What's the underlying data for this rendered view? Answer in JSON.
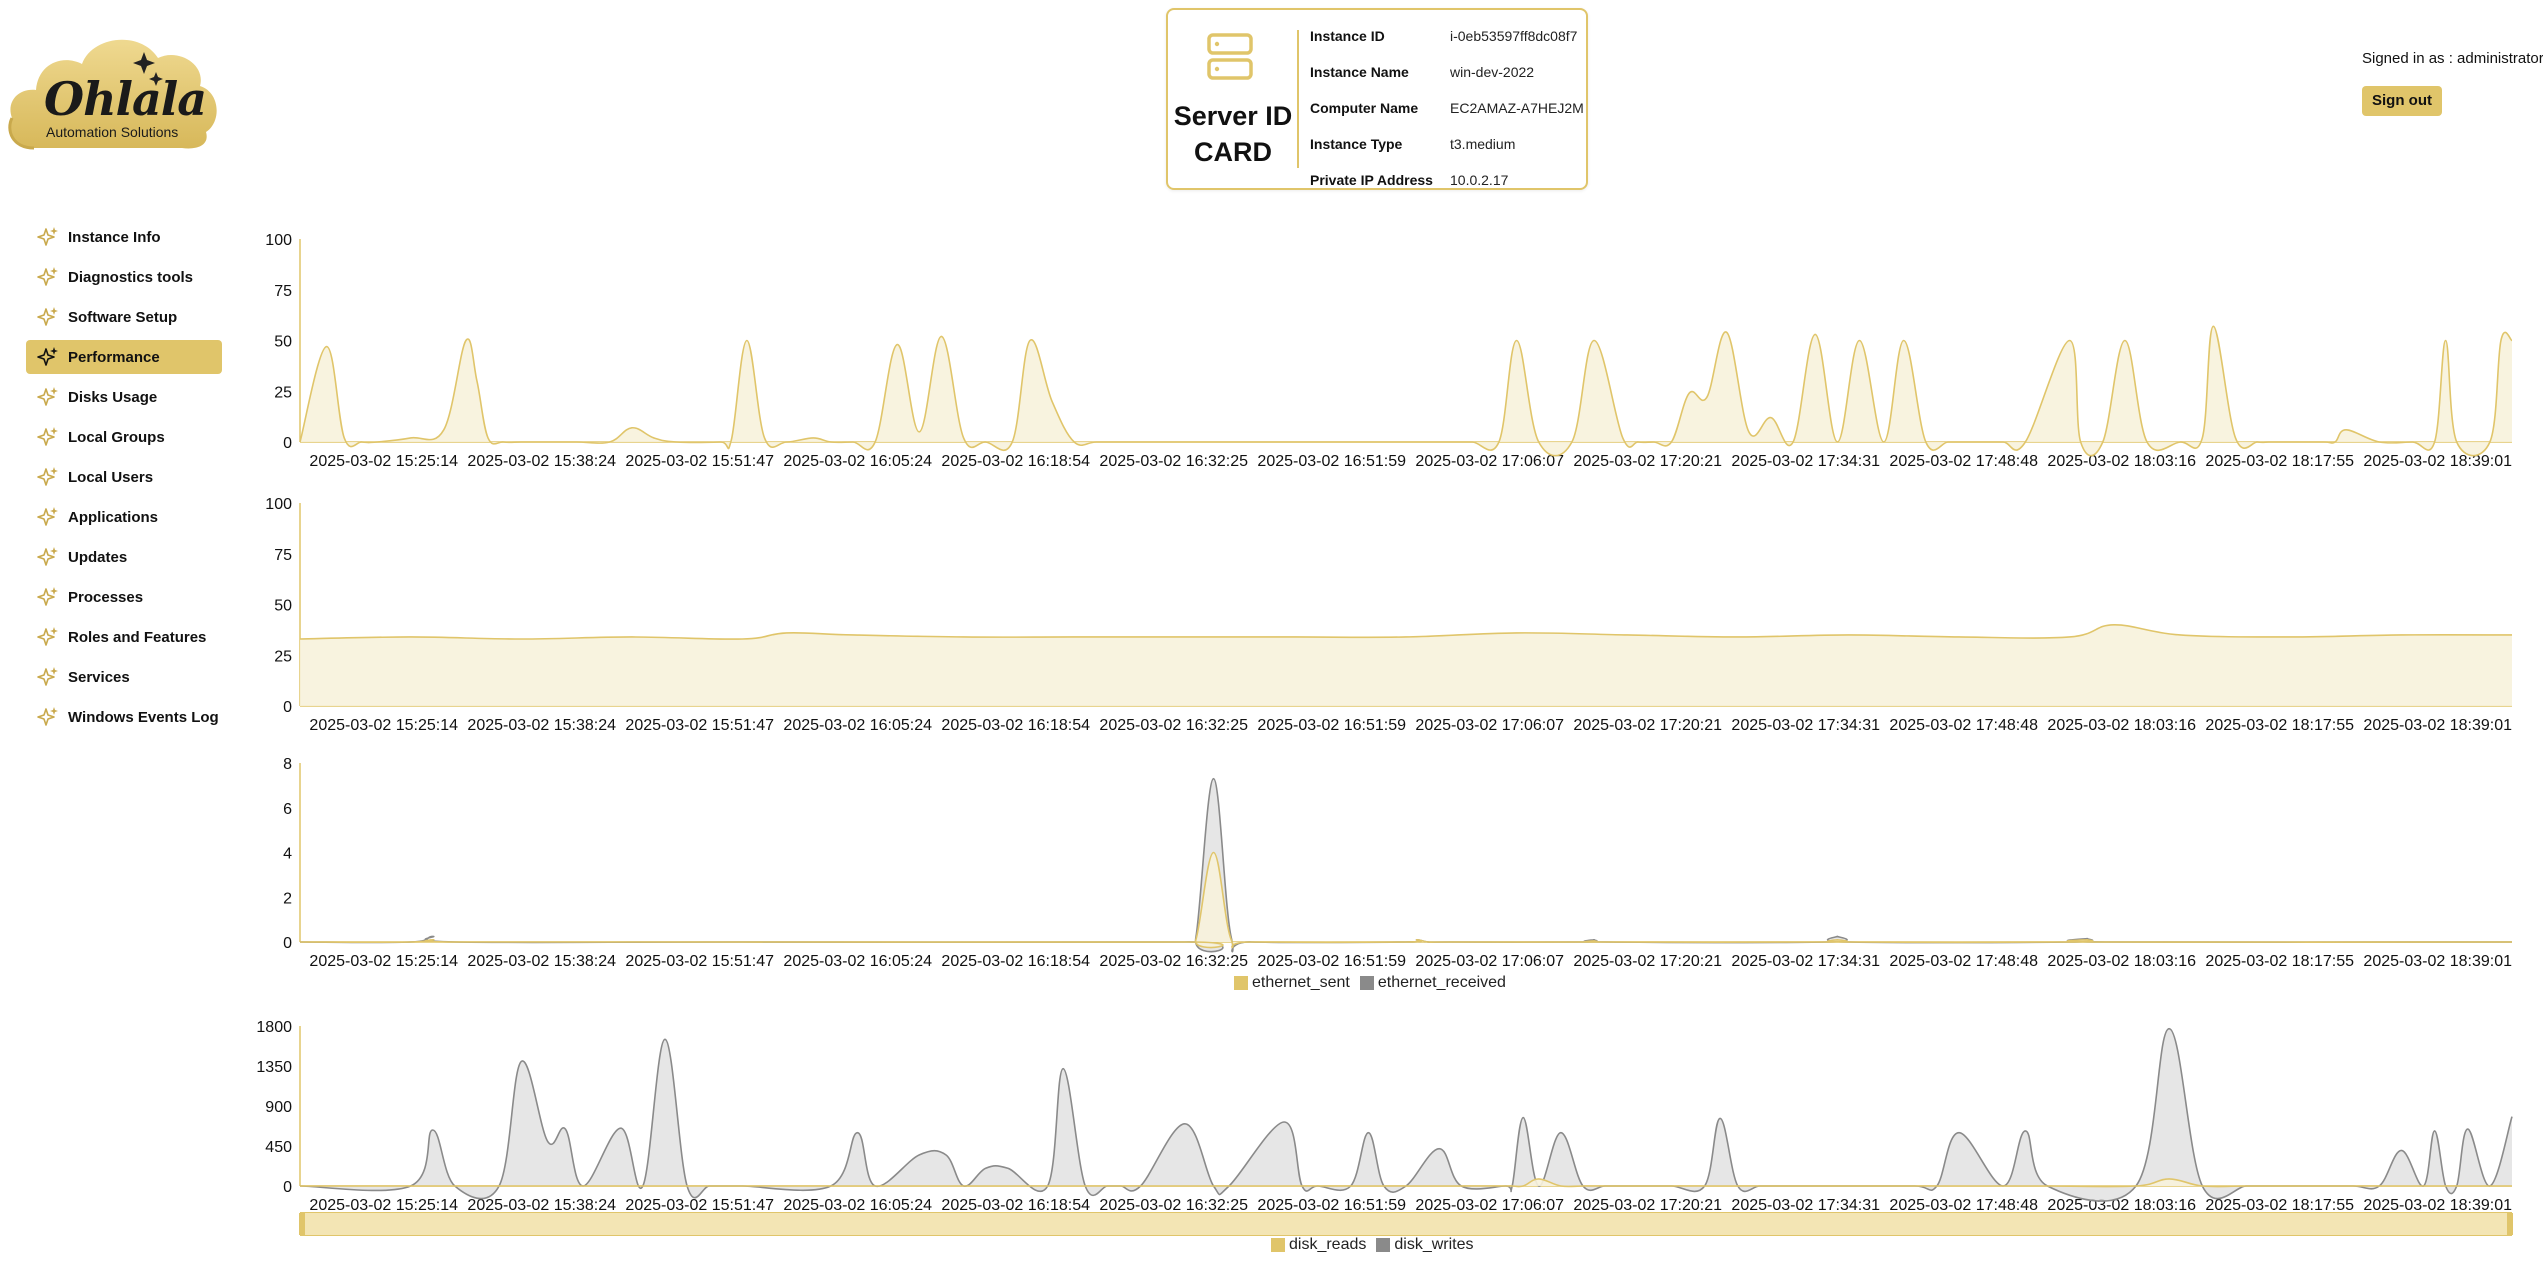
{
  "app": {
    "logo_text": "Ohlala",
    "logo_subtitle": "Automation Solutions"
  },
  "id_card": {
    "title_line1": "Server ID",
    "title_line2": "CARD",
    "rows": [
      {
        "key": "Instance ID",
        "value": "i-0eb53597ff8dc08f7"
      },
      {
        "key": "Instance Name",
        "value": "win-dev-2022"
      },
      {
        "key": "Computer Name",
        "value": "EC2AMAZ-A7HEJ2M"
      },
      {
        "key": "Instance Type",
        "value": "t3.medium"
      },
      {
        "key": "Private IP Address",
        "value": "10.0.2.17"
      }
    ]
  },
  "user": {
    "signed_in_text": "Signed in as : administrator",
    "sign_out_label": "Sign out"
  },
  "sidebar": {
    "items": [
      {
        "label": "Instance Info",
        "icon": "sparkle-icon",
        "active": false
      },
      {
        "label": "Diagnostics tools",
        "icon": "sparkle-icon",
        "active": false
      },
      {
        "label": "Software Setup",
        "icon": "sparkle-icon",
        "active": false
      },
      {
        "label": "Performance",
        "icon": "sparkle-icon",
        "active": true
      },
      {
        "label": "Disks Usage",
        "icon": "sparkle-icon",
        "active": false
      },
      {
        "label": "Local Groups",
        "icon": "sparkle-icon",
        "active": false
      },
      {
        "label": "Local Users",
        "icon": "sparkle-icon",
        "active": false
      },
      {
        "label": "Applications",
        "icon": "sparkle-icon",
        "active": false
      },
      {
        "label": "Updates",
        "icon": "sparkle-icon",
        "active": false
      },
      {
        "label": "Processes",
        "icon": "sparkle-icon",
        "active": false
      },
      {
        "label": "Roles and Features",
        "icon": "sparkle-icon",
        "active": false
      },
      {
        "label": "Services",
        "icon": "sparkle-icon",
        "active": false
      },
      {
        "label": "Windows Events Log",
        "icon": "sparkle-icon",
        "active": false
      }
    ]
  },
  "colors": {
    "accent": "#e0c56a",
    "fill_light": "#f7f2dc",
    "grey_line": "#8a8a8a",
    "grey_fill": "#e2e2e2"
  },
  "chart_data": [
    {
      "type": "area",
      "x_ticks": [
        "2025-03-02 15:25:14",
        "2025-03-02 15:38:24",
        "2025-03-02 15:51:47",
        "2025-03-02 16:05:24",
        "2025-03-02 16:18:54",
        "2025-03-02 16:32:25",
        "2025-03-02 16:51:59",
        "2025-03-02 17:06:07",
        "2025-03-02 17:20:21",
        "2025-03-02 17:34:31",
        "2025-03-02 17:48:48",
        "2025-03-02 18:03:16",
        "2025-03-02 18:17:55",
        "2025-03-02 18:39:01"
      ],
      "y_ticks": [
        "0",
        "25",
        "50",
        "75",
        "100"
      ],
      "ylim": [
        0,
        100
      ],
      "x": [
        0.0,
        0.012,
        0.02,
        0.028,
        0.035,
        0.05,
        0.065,
        0.075,
        0.08,
        0.085,
        0.092,
        0.1,
        0.11,
        0.125,
        0.14,
        0.15,
        0.16,
        0.17,
        0.19,
        0.195,
        0.202,
        0.21,
        0.22,
        0.232,
        0.24,
        0.25,
        0.26,
        0.27,
        0.28,
        0.29,
        0.3,
        0.31,
        0.322,
        0.33,
        0.34,
        0.35,
        0.36,
        0.375,
        0.39,
        0.4,
        0.41,
        0.42,
        0.44,
        0.46,
        0.47,
        0.48,
        0.49,
        0.5,
        0.52,
        0.53,
        0.542,
        0.55,
        0.56,
        0.575,
        0.585,
        0.598,
        0.605,
        0.612,
        0.62,
        0.628,
        0.636,
        0.645,
        0.655,
        0.665,
        0.675,
        0.685,
        0.695,
        0.705,
        0.716,
        0.725,
        0.735,
        0.745,
        0.752,
        0.76,
        0.77,
        0.78,
        0.8,
        0.805,
        0.815,
        0.825,
        0.835,
        0.85,
        0.86,
        0.865,
        0.875,
        0.885,
        0.89,
        0.895,
        0.9,
        0.915,
        0.92,
        0.925,
        0.94,
        0.955,
        0.965,
        0.97,
        0.975,
        0.99,
        0.995,
        1.0
      ],
      "y": [
        0,
        47,
        2,
        0,
        0,
        2,
        6,
        50,
        30,
        2,
        0,
        0,
        0,
        0,
        0,
        7,
        2,
        0,
        0,
        1,
        50,
        2,
        0,
        2,
        0,
        0,
        0,
        48,
        5,
        52,
        2,
        0,
        0,
        50,
        20,
        0,
        0,
        0,
        0,
        0,
        0,
        0,
        0,
        0,
        0,
        0,
        0,
        0,
        0,
        0,
        0,
        50,
        0,
        0,
        50,
        2,
        0,
        0,
        0,
        24,
        22,
        54,
        5,
        12,
        0,
        53,
        0,
        50,
        0,
        50,
        0,
        0,
        0,
        0,
        0,
        0,
        50,
        0,
        0,
        50,
        0,
        0,
        2,
        57,
        2,
        0,
        0,
        0,
        0,
        0,
        0,
        6,
        0,
        0,
        0,
        50,
        0,
        0,
        50,
        50
      ],
      "series": [
        {
          "color": "#e0c56a"
        }
      ]
    },
    {
      "type": "area",
      "x_ticks": [
        "2025-03-02 15:25:14",
        "2025-03-02 15:38:24",
        "2025-03-02 15:51:47",
        "2025-03-02 16:05:24",
        "2025-03-02 16:18:54",
        "2025-03-02 16:32:25",
        "2025-03-02 16:51:59",
        "2025-03-02 17:06:07",
        "2025-03-02 17:20:21",
        "2025-03-02 17:34:31",
        "2025-03-02 17:48:48",
        "2025-03-02 18:03:16",
        "2025-03-02 18:17:55",
        "2025-03-02 18:39:01"
      ],
      "y_ticks": [
        "0",
        "25",
        "50",
        "75",
        "100"
      ],
      "ylim": [
        0,
        100
      ],
      "x": [
        0.0,
        0.05,
        0.1,
        0.15,
        0.2,
        0.22,
        0.25,
        0.3,
        0.35,
        0.4,
        0.45,
        0.5,
        0.55,
        0.6,
        0.65,
        0.7,
        0.75,
        0.8,
        0.82,
        0.85,
        0.9,
        0.95,
        1.0
      ],
      "y": [
        33,
        34,
        33,
        34,
        33,
        36,
        35,
        34,
        34,
        34,
        34,
        34,
        36,
        35,
        34,
        35,
        34,
        34,
        40,
        35,
        34,
        35,
        35
      ],
      "series": [
        {
          "color": "#e0c56a"
        }
      ]
    },
    {
      "type": "area",
      "x_ticks": [
        "2025-03-02 15:25:14",
        "2025-03-02 15:38:24",
        "2025-03-02 15:51:47",
        "2025-03-02 16:05:24",
        "2025-03-02 16:18:54",
        "2025-03-02 16:32:25",
        "2025-03-02 16:51:59",
        "2025-03-02 17:06:07",
        "2025-03-02 17:20:21",
        "2025-03-02 17:34:31",
        "2025-03-02 17:48:48",
        "2025-03-02 18:03:16",
        "2025-03-02 18:17:55",
        "2025-03-02 18:39:01"
      ],
      "y_ticks": [
        "0",
        "2",
        "4",
        "6",
        "8"
      ],
      "ylim": [
        0,
        8
      ],
      "x": [
        0.0,
        0.05,
        0.06,
        0.07,
        0.2,
        0.4,
        0.405,
        0.413,
        0.421,
        0.43,
        0.5,
        0.505,
        0.51,
        0.52,
        0.58,
        0.585,
        0.59,
        0.69,
        0.695,
        0.7,
        0.8,
        0.808,
        0.816,
        1.0
      ],
      "series": [
        {
          "name": "ethernet_sent",
          "color": "#e0c56a",
          "y": [
            0,
            0,
            0.1,
            0,
            0,
            0,
            0.1,
            4.0,
            0.1,
            0,
            0,
            0.1,
            0,
            0,
            0,
            0.05,
            0,
            0,
            0.1,
            0,
            0,
            0.1,
            0,
            0
          ]
        },
        {
          "name": "ethernet_received",
          "color": "#8a8a8a",
          "y": [
            0,
            0,
            0.25,
            0,
            0,
            0,
            0.2,
            7.3,
            0.2,
            0,
            0,
            0.1,
            0,
            0,
            0,
            0.1,
            0,
            0,
            0.25,
            0,
            0,
            0.15,
            0,
            0
          ]
        }
      ]
    },
    {
      "type": "area",
      "x_ticks": [
        "2025-03-02 15:25:14",
        "2025-03-02 15:38:24",
        "2025-03-02 15:51:47",
        "2025-03-02 16:05:24",
        "2025-03-02 16:18:54",
        "2025-03-02 16:32:25",
        "2025-03-02 16:51:59",
        "2025-03-02 17:06:07",
        "2025-03-02 17:20:21",
        "2025-03-02 17:34:31",
        "2025-03-02 17:48:48",
        "2025-03-02 18:03:16",
        "2025-03-02 18:17:55",
        "2025-03-02 18:39:01"
      ],
      "y_ticks": [
        "0",
        "450",
        "900",
        "1350",
        "1800"
      ],
      "ylim": [
        0,
        1800
      ],
      "x": [
        0.0,
        0.05,
        0.06,
        0.07,
        0.09,
        0.1,
        0.112,
        0.12,
        0.128,
        0.145,
        0.155,
        0.165,
        0.175,
        0.185,
        0.193,
        0.2,
        0.24,
        0.252,
        0.26,
        0.28,
        0.292,
        0.3,
        0.31,
        0.32,
        0.338,
        0.345,
        0.355,
        0.365,
        0.371,
        0.38,
        0.4,
        0.413,
        0.42,
        0.445,
        0.453,
        0.46,
        0.475,
        0.483,
        0.49,
        0.5,
        0.515,
        0.525,
        0.545,
        0.548,
        0.553,
        0.56,
        0.57,
        0.58,
        0.59,
        0.6,
        0.608,
        0.62,
        0.635,
        0.642,
        0.65,
        0.66,
        0.67,
        0.68,
        0.7,
        0.73,
        0.74,
        0.75,
        0.77,
        0.78,
        0.79,
        0.83,
        0.845,
        0.86,
        0.88,
        0.89,
        0.9,
        0.91,
        0.928,
        0.94,
        0.95,
        0.96,
        0.965,
        0.97,
        0.975,
        0.98,
        0.99,
        1.0
      ],
      "series": [
        {
          "name": "disk_reads",
          "color": "#e0c56a",
          "y": [
            0,
            0,
            0,
            0,
            0,
            0,
            0,
            0,
            0,
            0,
            0,
            0,
            0,
            0,
            0,
            0,
            0,
            0,
            0,
            0,
            0,
            0,
            0,
            0,
            0,
            0,
            0,
            0,
            0,
            0,
            0,
            0,
            0,
            0,
            0,
            0,
            0,
            0,
            0,
            0,
            0,
            0,
            0,
            0,
            0,
            80,
            0,
            0,
            0,
            0,
            0,
            0,
            0,
            0,
            0,
            0,
            0,
            0,
            0,
            0,
            0,
            0,
            0,
            0,
            0,
            0,
            80,
            0,
            0,
            0,
            0,
            0,
            0,
            0,
            0,
            0,
            0,
            0,
            0,
            0,
            0,
            0
          ]
        },
        {
          "name": "disk_writes",
          "color": "#8a8a8a",
          "y": [
            0,
            0,
            630,
            0,
            0,
            1400,
            500,
            640,
            0,
            650,
            0,
            1650,
            0,
            0,
            0,
            0,
            0,
            600,
            0,
            350,
            350,
            0,
            200,
            200,
            0,
            1320,
            0,
            0,
            0,
            0,
            700,
            0,
            0,
            720,
            0,
            0,
            0,
            600,
            0,
            0,
            420,
            0,
            0,
            0,
            770,
            0,
            600,
            0,
            0,
            0,
            0,
            0,
            0,
            760,
            0,
            0,
            0,
            0,
            0,
            0,
            0,
            600,
            0,
            620,
            0,
            0,
            1770,
            0,
            0,
            0,
            0,
            0,
            0,
            0,
            400,
            0,
            620,
            0,
            0,
            640,
            0,
            780
          ]
        }
      ]
    }
  ]
}
